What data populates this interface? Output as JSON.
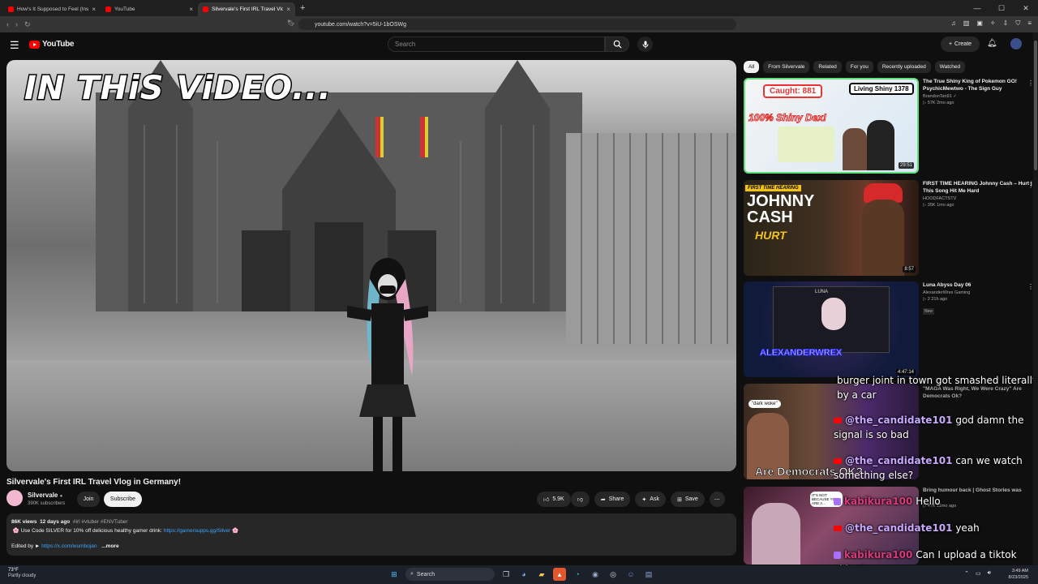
{
  "browser": {
    "tabs": [
      {
        "title": "How's It Supposed to Feel (Instrume...",
        "active": false
      },
      {
        "title": "YouTube",
        "active": false
      },
      {
        "title": "Silvervale's First IRL Travel Vlog...",
        "active": true
      }
    ],
    "url": "youtube.com/watch?v=5iU-1bOSWg"
  },
  "header": {
    "logo_text": "YouTube",
    "search_placeholder": "Search",
    "create_label": "Create"
  },
  "video": {
    "overlay_text": "IN THiS ViDEO...",
    "title": "Silvervale's First IRL Travel Vlog in Germany!"
  },
  "channel": {
    "name": "Silvervale",
    "subscribers": "390K subscribers",
    "join_label": "Join",
    "subscribe_label": "Subscribe"
  },
  "actions": {
    "likes": "5.9K",
    "share": "Share",
    "ask": "Ask",
    "save": "Save"
  },
  "description": {
    "views": "86K views",
    "age": "12 days ago",
    "tags": "#irl #vtuber #ENVTuber",
    "line1_prefix": "🌸 Use Code SILVER for 10% off delicious healthy gamer drink:",
    "line1_link": "https://gamersupps.gg/Silver",
    "line1_suffix": "🌸",
    "line2_prefix": "Edited by ►",
    "line2_link": "https://x.com/wumbojan",
    "more": "...more"
  },
  "chips": [
    "All",
    "From Silvervale",
    "Related",
    "For you",
    "Recently uploaded",
    "Watched"
  ],
  "recommendations": [
    {
      "title": "The True Shiny King of Pokemon GO! PsychicMewtwo - The Sign Guy",
      "channel": "BrandonTan91 ✓",
      "stats": "▷ 57K  2mo ago",
      "duration": "29:51",
      "thumb_text_1": "Caught: 881",
      "thumb_text_2": "100% Shiny Dex!",
      "thumb_text_3": "Living Shiny 1378"
    },
    {
      "title": "FIRST TIME HEARING Johnny Cash – Hurt | This Song Hit Me Hard",
      "channel": "HOODFACTSTV",
      "stats": "▷ 35K  1mo ago",
      "duration": "8:57",
      "thumb_text_1": "FIRST TIME HEARING",
      "thumb_text_2": "JOHNNY CASH",
      "thumb_text_3": "HURT"
    },
    {
      "title": "Luna Abyss Day 06",
      "channel": "AlexanderWrex Gaming",
      "stats": "▷ 2  21h ago",
      "badge": "New",
      "duration": "4:47:14",
      "thumb_text_1": "LUNA",
      "thumb_text_2": "ALEXANDERWREX"
    },
    {
      "title": "\"MAGA Was Right, We Were Crazy\" Are Democrats Ok?",
      "channel": "",
      "stats": "",
      "duration": "",
      "thumb_text_1": "\"dark woke\"",
      "thumb_text_2": "Are Democrats OK?"
    },
    {
      "title": "Bring humour back | Ghost Stories was",
      "channel": "",
      "stats": "▷ 47K  11mo ago",
      "duration": "",
      "thumb_text_1": "IT'S NOT BECAUSE YOU ARE A..."
    }
  ],
  "chat": [
    {
      "user": "",
      "text": "burger joint in town got smashed literally by a car",
      "platform": "none"
    },
    {
      "user": "@the_candidate101",
      "text": "god damn the signal is so bad",
      "platform": "youtube"
    },
    {
      "user": "@the_candidate101",
      "text": "can we watch something else?",
      "platform": "youtube"
    },
    {
      "user": "kabikura100",
      "text": "Hello",
      "platform": "twitch"
    },
    {
      "user": "@the_candidate101",
      "text": "yeah",
      "platform": "youtube"
    },
    {
      "user": "kabikura100",
      "text": "Can I upload a tiktok video?",
      "platform": "twitch"
    }
  ],
  "taskbar": {
    "weather_temp": "73°F",
    "weather_cond": "Partly cloudy",
    "search": "Search",
    "time": "3:49 AM",
    "date": "8/23/2025"
  }
}
